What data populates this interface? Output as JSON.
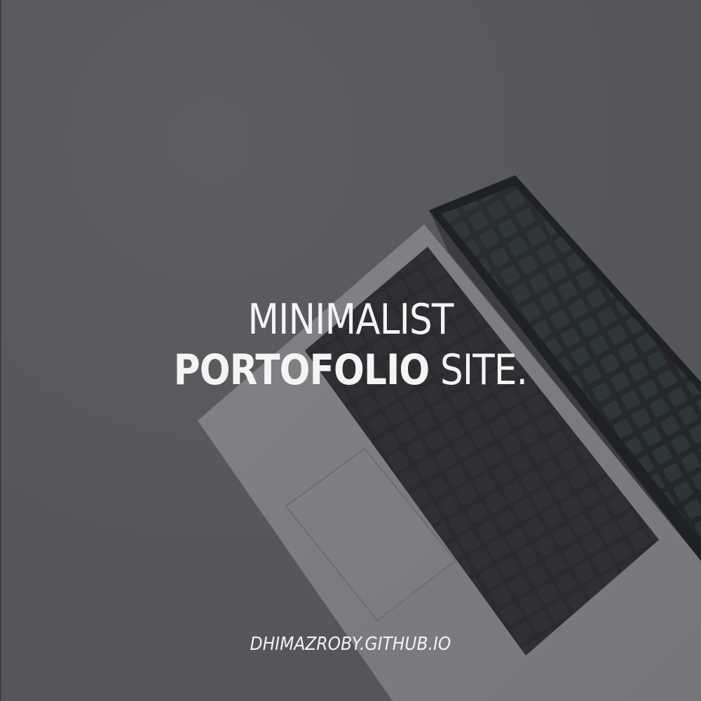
{
  "hero": {
    "line1": "MINIMALIST",
    "line2_bold": "PORTOFOLIO",
    "line2_rest": " SITE."
  },
  "footer": {
    "url_text": "DHIMAZROBY.GITHUB.IO"
  },
  "colors": {
    "background": "#5c5d61",
    "text": "#f4f4f4",
    "laptop_body": "#8d8e92",
    "keyboard_key": "#2b2c2f",
    "screen": "#1f2326"
  }
}
